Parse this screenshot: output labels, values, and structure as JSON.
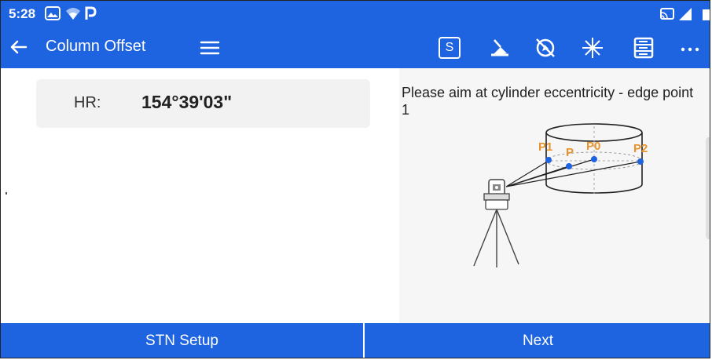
{
  "status_bar": {
    "time": "5:28",
    "icons": [
      "gallery-icon",
      "wifi-icon",
      "p-app-icon",
      "cast-icon",
      "signal-icon",
      "battery-icon"
    ]
  },
  "app_bar": {
    "title": "Column Offset",
    "back_icon": "arrow-left-icon",
    "menu_icon": "hamburger-menu-icon",
    "tools": {
      "s_label": "S",
      "icons": [
        "laser-pointer-icon",
        "compass-off-icon",
        "star-burst-icon",
        "list-panel-icon",
        "more-icon"
      ]
    }
  },
  "measurement": {
    "hr_label": "HR:",
    "hr_value": "154°39'03\""
  },
  "instruction": {
    "text": "Please aim at cylinder eccentricity - edge point 1"
  },
  "diagram": {
    "point_labels": [
      "P1",
      "P",
      "P0",
      "P2"
    ],
    "label_color": "#e8932b",
    "point_color": "#1e63e0"
  },
  "bottom_bar": {
    "left_label": "STN Setup",
    "right_label": "Next"
  },
  "colors": {
    "primary": "#1e63e0",
    "background": "#ffffff",
    "panel": "#f6f6f6"
  }
}
